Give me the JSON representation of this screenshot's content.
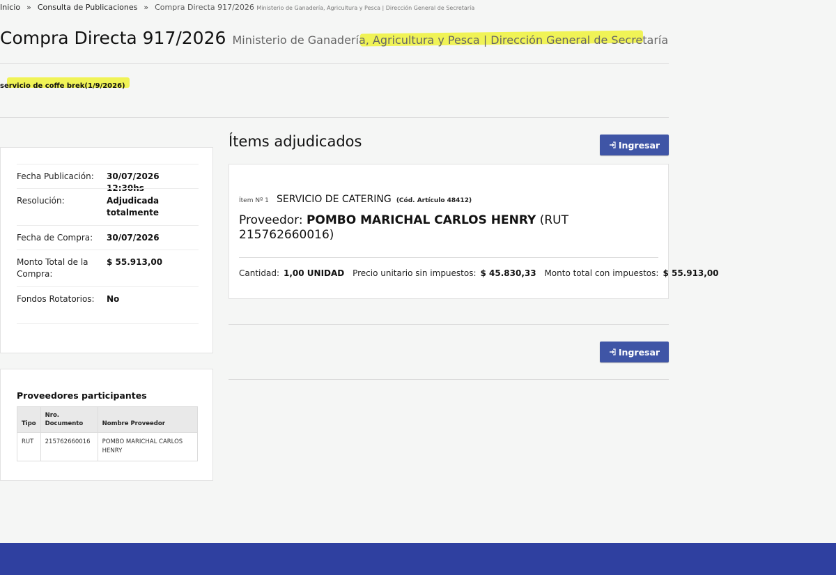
{
  "breadcrumb": {
    "items": [
      "Inicio",
      "Consulta de Publicaciones"
    ],
    "separator": "»",
    "current": "Compra Directa 917/2026",
    "current_sub": "Ministerio de Ganadería, Agricultura y Pesca | Dirección General de Secretaría"
  },
  "header": {
    "title": "Compra Directa 917/2026",
    "subtitle": "Ministerio de Ganadería, Agricultura y Pesca | Dirección General de Secretaría"
  },
  "description": "servicio de coffe brek(1/9/2026)",
  "info": {
    "rows": [
      {
        "label": "Fecha Publicación:",
        "value": "30/07/2026 12:30hs"
      },
      {
        "label": "Resolución:",
        "value": "Adjudicada totalmente"
      },
      {
        "label": "Fecha de Compra:",
        "value": "30/07/2026"
      },
      {
        "label": "Monto Total de la Compra:",
        "value": "$ 55.913,00"
      },
      {
        "label": "Fondos Rotatorios:",
        "value": "No"
      }
    ]
  },
  "providers": {
    "title": "Proveedores participantes",
    "columns": [
      "Tipo",
      "Nro. Documento",
      "Nombre Proveedor"
    ],
    "rows": [
      {
        "tipo": "RUT",
        "doc": "215762660016",
        "nombre": "POMBO MARICHAL CARLOS HENRY"
      }
    ]
  },
  "items_section": {
    "title": "Ítems adjudicados",
    "login_button": "Ingresar",
    "item": {
      "num": "Ítem Nº 1",
      "name": "SERVICIO DE CATERING",
      "code": "(Cód. Artículo 48412)",
      "provider_label": "Proveedor:",
      "provider_name": "POMBO MARICHAL CARLOS HENRY",
      "provider_rut": "(RUT 215762660016)",
      "quantity_label": "Cantidad:",
      "quantity": "1,00 UNIDAD",
      "unit_price_label": "Precio unitario sin impuestos:",
      "unit_price": "$ 45.830,33",
      "total_label": "Monto total con impuestos:",
      "total": "$ 55.913,00"
    }
  },
  "colors": {
    "primary_button": "#3f55a6",
    "footer": "#2f40a0",
    "highlight": "#eef23a"
  },
  "icons": {
    "login": "sign-in-icon"
  }
}
